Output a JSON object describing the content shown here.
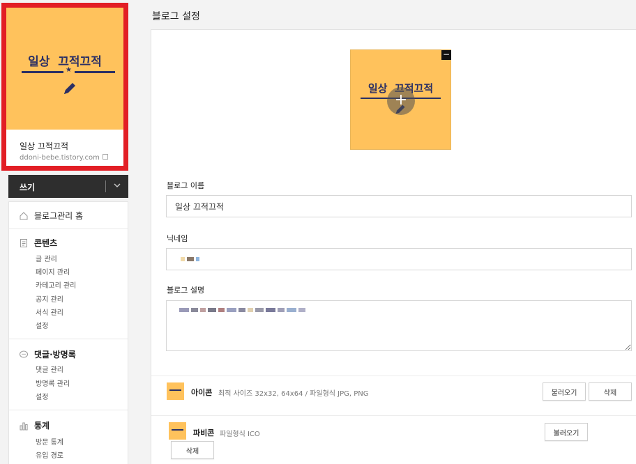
{
  "profile": {
    "banner_title": "일상  끄적끄적",
    "blog_name": "일상 끄적끄적",
    "blog_url": "ddoni-bebe.tistory.com"
  },
  "write": {
    "label": "쓰기"
  },
  "menu": {
    "home": "블로그관리 홈",
    "content": {
      "title": "콘텐츠",
      "items": [
        "글 관리",
        "페이지 관리",
        "카테고리 관리",
        "공지 관리",
        "서식 관리",
        "설정"
      ]
    },
    "comments": {
      "title": "댓글·방명록",
      "items": [
        "댓글 관리",
        "방명록 관리",
        "설정"
      ]
    },
    "stats": {
      "title": "통계",
      "items": [
        "방문 통계",
        "유입 경로"
      ]
    }
  },
  "page": {
    "title": "블로그 설정"
  },
  "form": {
    "image_banner_title": "일상  끄적끄적",
    "image_minus": "−",
    "image_plus": "+",
    "blog_name_label": "블로그 이름",
    "blog_name_value": "일상 끄적끄적",
    "nickname_label": "닉네임",
    "description_label": "블로그 설명"
  },
  "icon_row": {
    "title": "아이콘",
    "desc": "최적 사이즈 32x32, 64x64 / 파일형식 JPG, PNG",
    "load_button": "불러오기",
    "delete_button": "삭제"
  },
  "favicon_row": {
    "title": "파비콘",
    "desc": "파일형식 ICO",
    "load_button": "불러오기",
    "delete_button": "삭제"
  },
  "colors": {
    "banner_yellow": "#ffc25c",
    "banner_navy": "#2b2f64",
    "highlight_red": "#e21e25",
    "write_bar": "#2e2e2e"
  },
  "icons": [
    "external-link-icon",
    "chevron-down-icon",
    "home-icon",
    "document-icon",
    "comment-icon",
    "bar-chart-icon",
    "pencil-icon",
    "minus-icon",
    "plus-icon",
    "resize-handle-icon"
  ]
}
